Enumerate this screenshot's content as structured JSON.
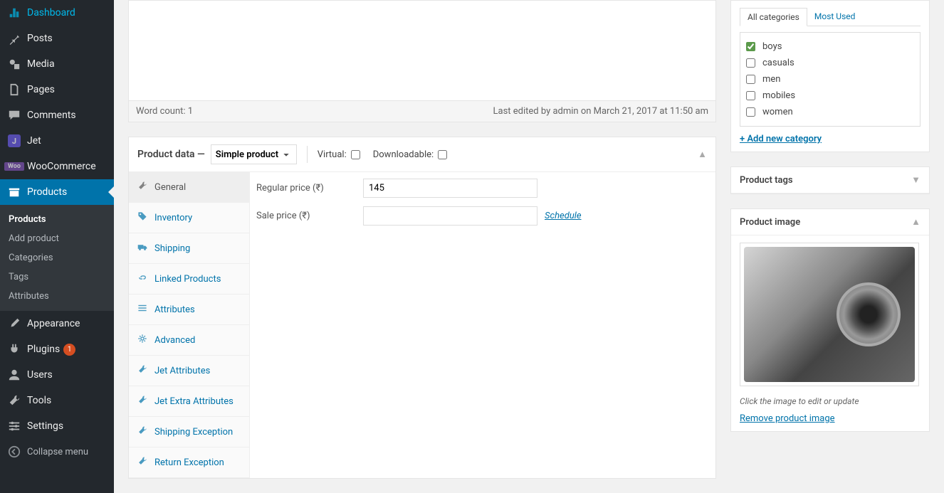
{
  "sidebar": {
    "items": [
      {
        "label": "Dashboard",
        "icon": "dashboard"
      },
      {
        "label": "Posts",
        "icon": "pin"
      },
      {
        "label": "Media",
        "icon": "media"
      },
      {
        "label": "Pages",
        "icon": "pages"
      },
      {
        "label": "Comments",
        "icon": "comment"
      },
      {
        "label": "Jet",
        "icon": "jet"
      },
      {
        "label": "WooCommerce",
        "icon": "woo"
      },
      {
        "label": "Products",
        "icon": "archive",
        "active": true
      },
      {
        "label": "Appearance",
        "icon": "brush"
      },
      {
        "label": "Plugins",
        "icon": "plug",
        "badge": "1"
      },
      {
        "label": "Users",
        "icon": "users"
      },
      {
        "label": "Tools",
        "icon": "tools"
      },
      {
        "label": "Settings",
        "icon": "settings"
      }
    ],
    "submenu": [
      {
        "label": "Products",
        "current": true
      },
      {
        "label": "Add product"
      },
      {
        "label": "Categories"
      },
      {
        "label": "Tags"
      },
      {
        "label": "Attributes"
      }
    ],
    "collapse": "Collapse menu"
  },
  "editor": {
    "word_count": "Word count: 1",
    "last_edited": "Last edited by admin on March 21, 2017 at 11:50 am"
  },
  "product_data": {
    "title": "Product data —",
    "type": "Simple product",
    "virtual_label": "Virtual:",
    "downloadable_label": "Downloadable:",
    "tabs": [
      {
        "label": "General",
        "icon": "wrench",
        "active": true
      },
      {
        "label": "Inventory",
        "icon": "tag"
      },
      {
        "label": "Shipping",
        "icon": "truck"
      },
      {
        "label": "Linked Products",
        "icon": "link"
      },
      {
        "label": "Attributes",
        "icon": "list"
      },
      {
        "label": "Advanced",
        "icon": "gear"
      },
      {
        "label": "Jet Attributes",
        "icon": "wrench"
      },
      {
        "label": "Jet Extra Attributes",
        "icon": "wrench"
      },
      {
        "label": "Shipping Exception",
        "icon": "wrench"
      },
      {
        "label": "Return Exception",
        "icon": "wrench"
      }
    ],
    "fields": {
      "regular_price_label": "Regular price (₹)",
      "regular_price_value": "145",
      "sale_price_label": "Sale price (₹)",
      "sale_price_value": "",
      "schedule": "Schedule"
    }
  },
  "categories": {
    "tabs": {
      "all": "All categories",
      "most_used": "Most Used"
    },
    "items": [
      {
        "label": "boys",
        "checked": true
      },
      {
        "label": "casuals",
        "checked": false
      },
      {
        "label": "men",
        "checked": false
      },
      {
        "label": "mobiles",
        "checked": false
      },
      {
        "label": "women",
        "checked": false
      }
    ],
    "add_new": "+ Add new category"
  },
  "product_tags": {
    "title": "Product tags"
  },
  "product_image": {
    "title": "Product image",
    "hint": "Click the image to edit or update",
    "remove": "Remove product image"
  }
}
